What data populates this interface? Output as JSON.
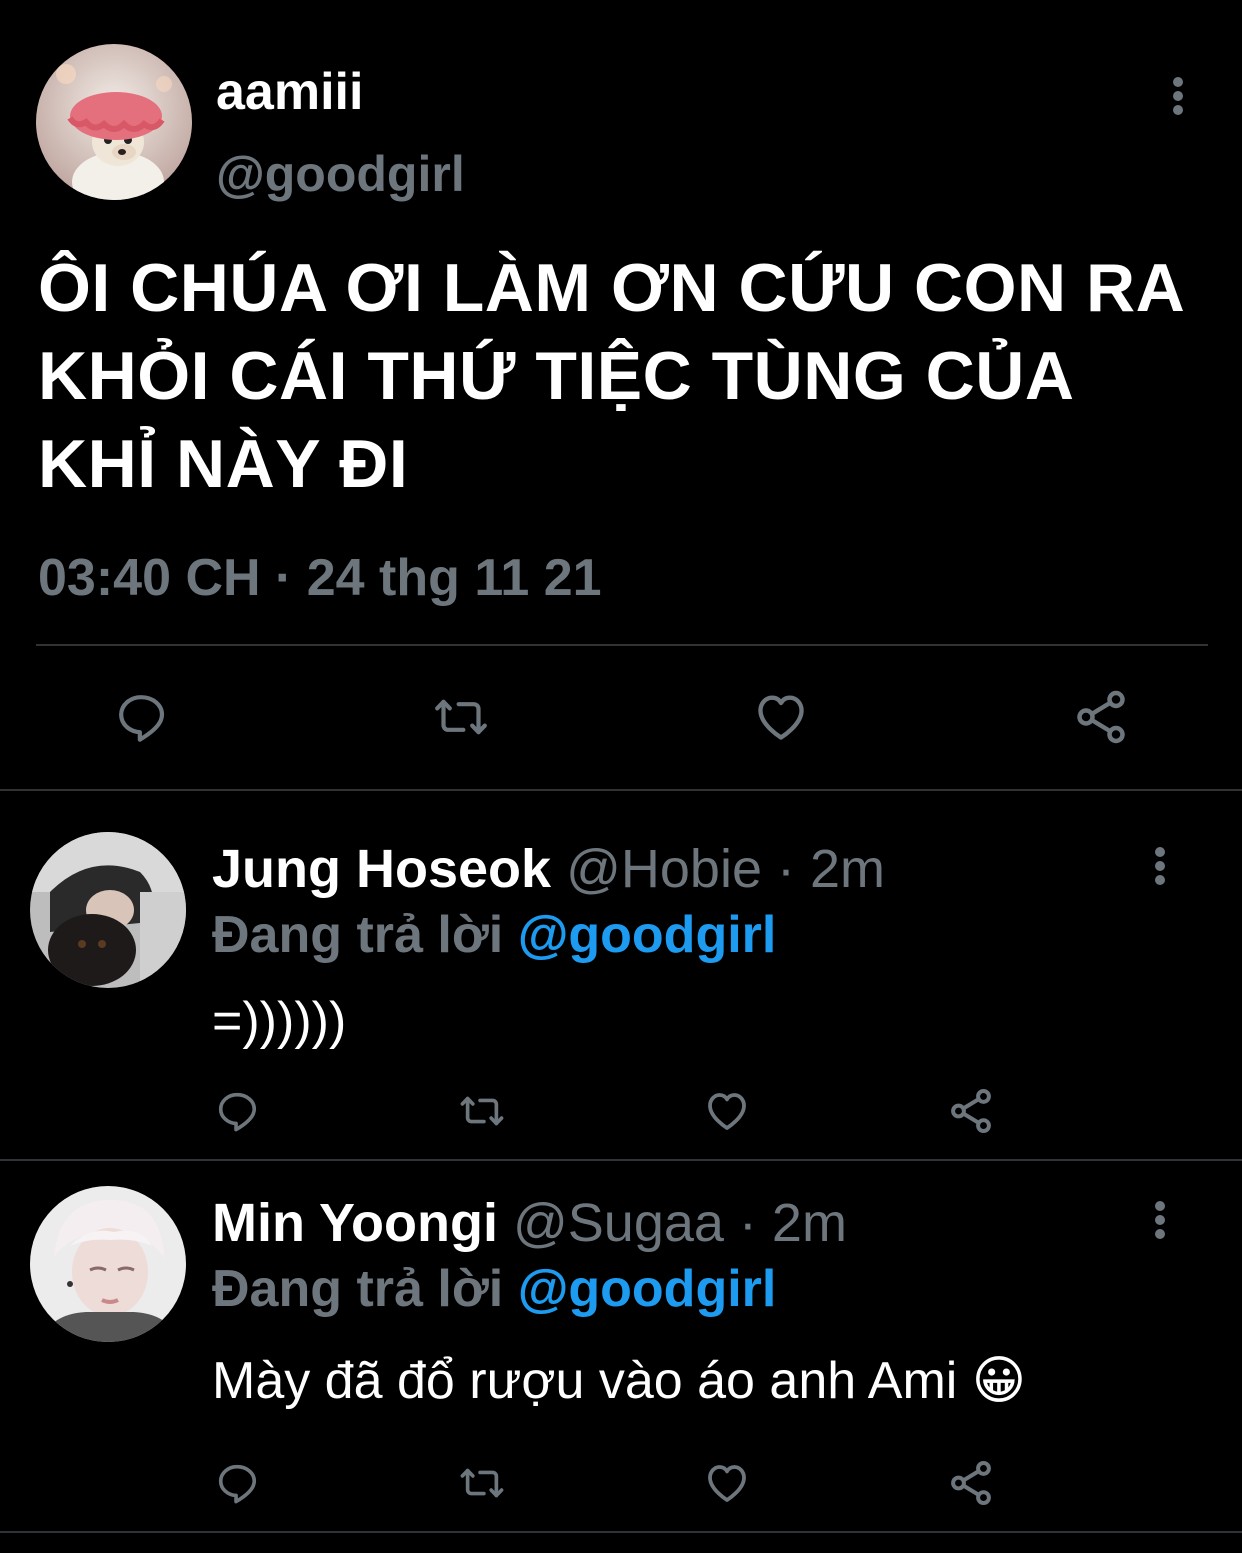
{
  "main_tweet": {
    "display_name": "aamiii",
    "handle": "@goodgirl",
    "text": "ÔI CHÚA ƠI LÀM ƠN CỨU CON RA KHỎI CÁI THỨ TIỆC TÙNG CỦA KHỈ NÀY ĐI",
    "timestamp": "03:40 CH · 24 thg 11 21",
    "avatar_icon": "chihuahua-shower-cap-avatar"
  },
  "replies": [
    {
      "display_name": "Jung Hoseok",
      "meta": "@Hobie · 2m",
      "replying_label": "Đang trả lời",
      "replying_to": "@goodgirl",
      "text": "=))))))",
      "avatar_icon": "man-hugging-dog-avatar"
    },
    {
      "display_name": "Min Yoongi",
      "meta": "@Sugaa · 2m",
      "replying_label": "Đang trả lời",
      "replying_to": "@goodgirl",
      "text": "Mày đã đổ rượu vào áo anh Ami",
      "emoji": "😀",
      "avatar_icon": "pale-hair-man-avatar"
    }
  ],
  "colors": {
    "background": "#000000",
    "primary_text": "#ffffff",
    "secondary_text": "#6e767d",
    "mention": "#1d9bf0",
    "divider": "#2f3336"
  }
}
